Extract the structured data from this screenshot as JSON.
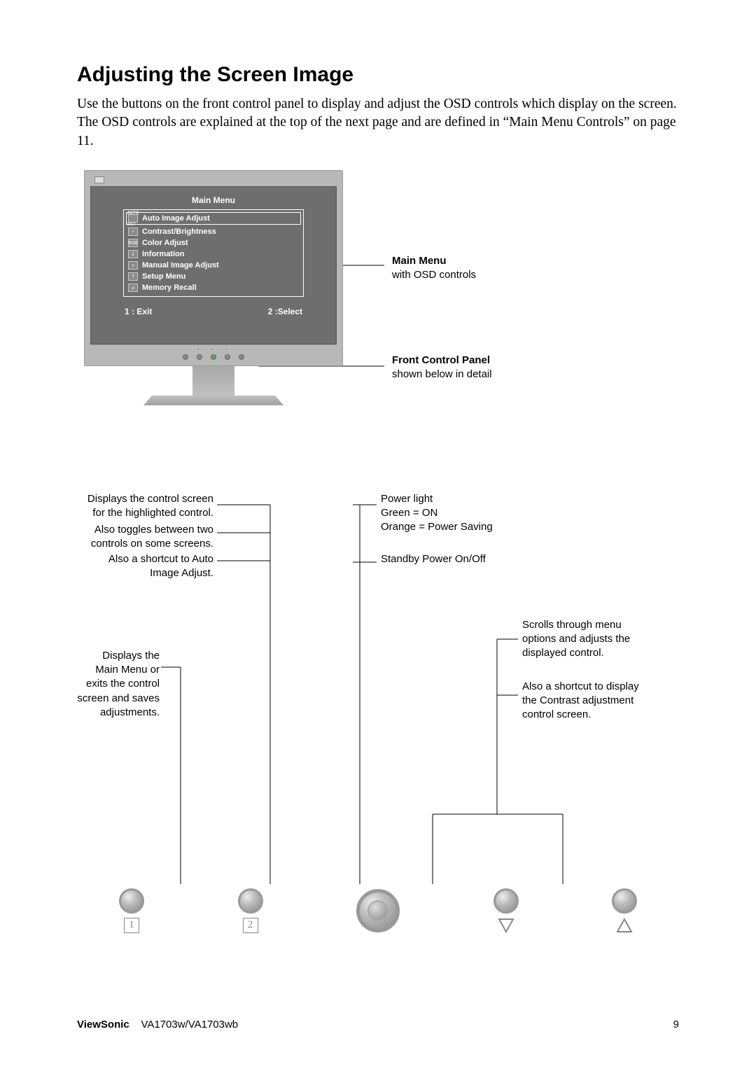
{
  "title": "Adjusting the Screen Image",
  "intro": "Use the buttons on the front control panel to display and adjust the OSD controls which display on the screen. The OSD controls are explained at the top of the next page and are defined in “Main Menu Controls” on page 11.",
  "osd": {
    "title": "Main Menu",
    "items": [
      "Auto Image Adjust",
      "Contrast/Brightness",
      "Color Adjust",
      "Information",
      "Manual Image Adjust",
      "Setup Menu",
      "Memory Recall"
    ],
    "icons": [
      "AUTO SET",
      "☀",
      "RGB",
      "i",
      "✣",
      "?",
      "↺"
    ],
    "footer_left": "1 : Exit",
    "footer_right": "2 :Select"
  },
  "fig1_labels": {
    "main_head": "Main Menu",
    "main_sub": "with OSD controls",
    "panel_head": "Front Control Panel",
    "panel_sub": "shown below in detail"
  },
  "ann": {
    "btn2_a": "Displays the control screen for the highlighted control.",
    "btn2_b": "Also toggles between two controls on some screens.",
    "btn2_c": "Also a shortcut to Auto Image Adjust.",
    "btn1": "Displays the Main Menu or exits the control screen and saves adjustments.",
    "power_light": "Power light\nGreen = ON\nOrange = Power Saving",
    "standby": "Standby Power On/Off",
    "arrows_a": "Scrolls through menu options and adjusts the displayed control.",
    "arrows_b": "Also a shortcut to display the Contrast adjustment control screen."
  },
  "buttons": {
    "b1": "1",
    "b2": "2"
  },
  "footer": {
    "brand": "ViewSonic",
    "model": "VA1703w/VA1703wb",
    "page": "9"
  }
}
